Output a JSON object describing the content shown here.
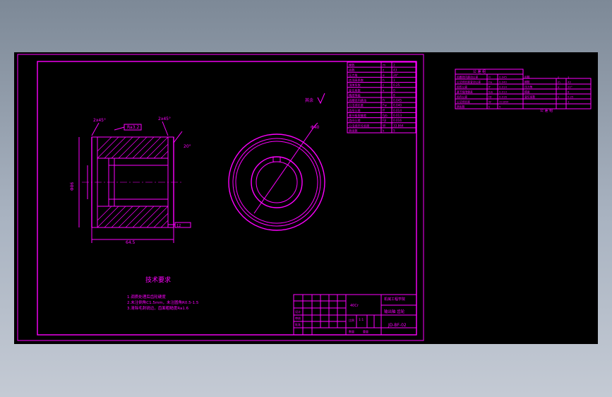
{
  "drawing": {
    "tech_title": "技术要求",
    "notes": [
      "1.调质处理后齿轮硬度",
      "2.未注倒角C1.5mm，未注圆角R0.5-1.5",
      "3.清除毛刺锐边，齿面粗糙度Ra1.6"
    ],
    "roughness_label": "其余",
    "dims": {
      "overall_width": "64.5",
      "bore_dia": "Φ40",
      "outer_dia": "Φ86",
      "chamfer": "2x45°",
      "angle": "20°",
      "keyway": "12",
      "finish": "Ra3.2"
    }
  },
  "param_table": {
    "header": "参数",
    "sub_header": "公差组",
    "rows": [
      [
        "模数",
        "m",
        "2"
      ],
      [
        "齿数",
        "z",
        "43"
      ],
      [
        "压力角",
        "α",
        "20°"
      ],
      [
        "齿顶高系数",
        "h",
        "1"
      ],
      [
        "顶隙系数",
        "c",
        "0.25"
      ],
      [
        "变位系数",
        "x",
        "0"
      ],
      [
        "精度等级",
        "",
        "8"
      ],
      [
        "齿圈径向跳动",
        "Fr",
        "0.045"
      ],
      [
        "公法线长度",
        "Fw",
        "0.040"
      ],
      [
        "齿形公差",
        "ff",
        "0.014"
      ],
      [
        "基节极限偏差",
        "fpb",
        "0.013"
      ],
      [
        "齿向公差",
        "Fβ",
        "0.016"
      ],
      [
        "公法线平均长度",
        "W",
        "33.864"
      ],
      [
        "跨齿数",
        "k",
        "5"
      ]
    ]
  },
  "title_block": {
    "school": "机械工程学院",
    "part_name": "输出轴 齿轮",
    "drawing_no": "JD-BF-02",
    "material": "40Cr",
    "scale": "1:1",
    "labels": [
      "设计",
      "审核",
      "批准",
      "比例",
      "数量",
      "重量"
    ]
  },
  "side_table": {
    "header": "公 差 组",
    "footer": "公 差 组",
    "rows": [
      [
        "齿圈径向跳动公差",
        "Fr",
        "0.045",
        "齿数",
        "z",
        "1"
      ],
      [
        "公法线长度变动公差",
        "Fw",
        "0.040",
        "模数",
        "m",
        "43"
      ],
      [
        "齿形公差",
        "ff",
        "0.014",
        "压力角",
        "α",
        "20°"
      ],
      [
        "基节极限偏差",
        "fpb",
        "0.013",
        "精度",
        "",
        "8"
      ],
      [
        "齿向公差",
        "Fβ",
        "0.016",
        "变位系数",
        "x",
        "0.25"
      ],
      [
        "公法线长度",
        "W",
        "33.864",
        "",
        "",
        "1"
      ],
      [
        "跨齿数",
        "k",
        "5",
        "",
        "",
        ""
      ]
    ]
  }
}
